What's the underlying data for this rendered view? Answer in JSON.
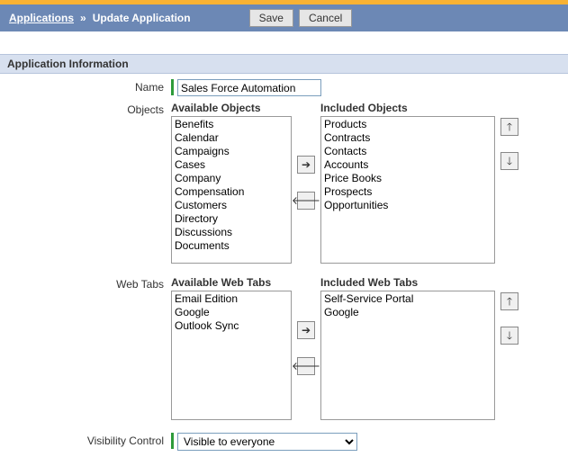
{
  "header": {
    "link": "Applications",
    "separator": "»",
    "title": "Update Application",
    "save_label": "Save",
    "cancel_label": "Cancel"
  },
  "section_title": "Application Information",
  "name": {
    "label": "Name",
    "value": "Sales Force Automation"
  },
  "objects": {
    "label": "Objects",
    "available_title": "Available Objects",
    "included_title": "Included Objects",
    "available": [
      "Benefits",
      "Calendar",
      "Campaigns",
      "Cases",
      "Company",
      "Compensation",
      "Customers",
      "Directory",
      "Discussions",
      "Documents"
    ],
    "included": [
      "Products",
      "Contracts",
      "Contacts",
      "Accounts",
      "Price Books",
      "Prospects",
      "Opportunities"
    ]
  },
  "webtabs": {
    "label": "Web Tabs",
    "available_title": "Available Web Tabs",
    "included_title": "Included Web Tabs",
    "available": [
      "Email Edition",
      "Google",
      "Outlook Sync"
    ],
    "included": [
      "Self-Service Portal",
      "Google"
    ]
  },
  "visibility": {
    "label": "Visibility Control",
    "options": [
      "Visible to everyone"
    ],
    "selected": "Visible to everyone"
  },
  "icons": {
    "right": "➔",
    "left": "←",
    "up": "↑",
    "down": "↓"
  }
}
